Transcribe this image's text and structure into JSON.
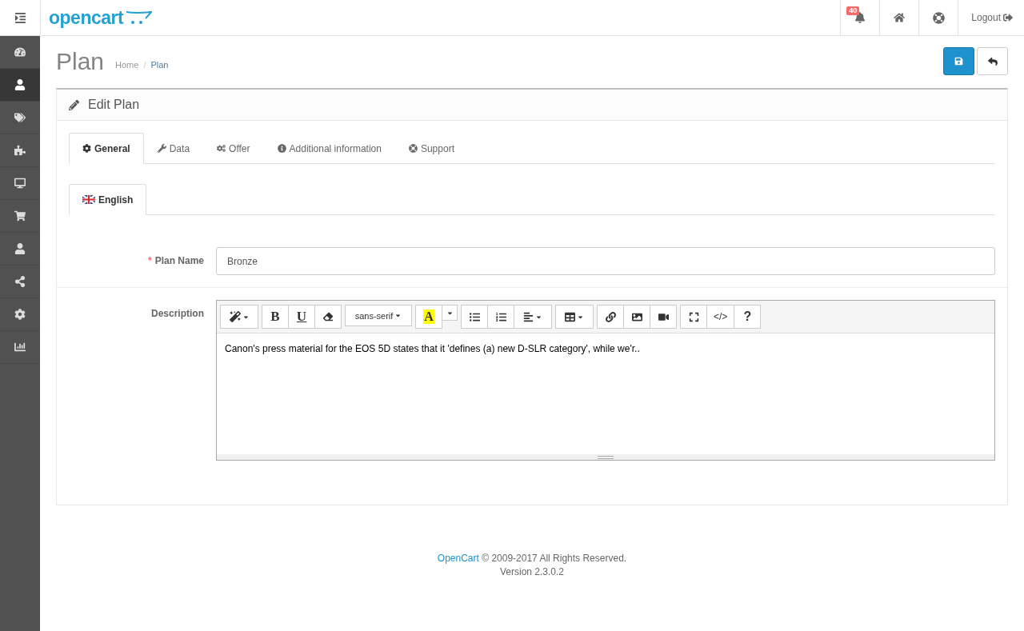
{
  "header": {
    "logo": "opencart",
    "notifications": {
      "count": "40"
    },
    "logout": "Logout"
  },
  "sidebar": {
    "items": [
      {
        "selected": false
      },
      {
        "selected": true
      },
      {
        "selected": false
      },
      {
        "selected": false
      },
      {
        "selected": false
      },
      {
        "selected": false
      },
      {
        "selected": false
      },
      {
        "selected": false
      },
      {
        "selected": false
      },
      {
        "selected": false
      }
    ]
  },
  "page": {
    "title": "Plan",
    "breadcrumb": [
      "Home",
      "Plan"
    ],
    "breadcrumb_separator": "/"
  },
  "panel": {
    "title": "Edit Plan",
    "tabs": [
      {
        "label": "General",
        "selected": true
      },
      {
        "label": "Data",
        "selected": false
      },
      {
        "label": "Offer",
        "selected": false
      },
      {
        "label": "Additional information",
        "selected": false
      },
      {
        "label": "Support",
        "selected": false
      }
    ],
    "language_tabs": [
      {
        "label": "English",
        "selected": true
      }
    ],
    "plan_name": {
      "label": "Plan Name",
      "required_mark": "*",
      "value": "Bronze"
    },
    "description": {
      "label": "Description",
      "text": "Canon's press material for the EOS 5D states that it 'defines (a) new D-SLR category', while we'r..",
      "toolbar": [
        [
          {
            "kind": "magic"
          }
        ],
        [
          {
            "kind": "bold",
            "label": "B"
          },
          {
            "kind": "underline",
            "label": "U"
          },
          {
            "kind": "eraser"
          }
        ],
        [
          {
            "kind": "font",
            "label": "sans-serif"
          }
        ],
        [
          {
            "kind": "color",
            "label": "A"
          },
          {
            "kind": "caret"
          }
        ],
        [
          {
            "kind": "ul"
          },
          {
            "kind": "ol"
          },
          {
            "kind": "align"
          }
        ],
        [
          {
            "kind": "table"
          }
        ],
        [
          {
            "kind": "link"
          },
          {
            "kind": "picture"
          },
          {
            "kind": "video"
          }
        ],
        [
          {
            "kind": "fullscreen"
          },
          {
            "kind": "code",
            "label": "</>"
          },
          {
            "kind": "help",
            "label": "?"
          }
        ]
      ]
    }
  },
  "footer": {
    "link": "OpenCart",
    "copyright": "© 2009-2017 All Rights Reserved.",
    "version": "Version 2.3.0.2"
  }
}
